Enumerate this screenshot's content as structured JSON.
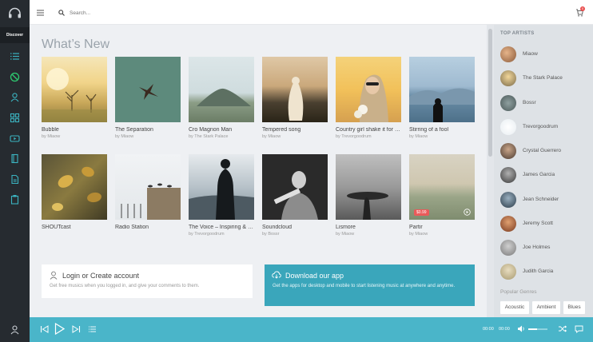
{
  "sidebar": {
    "discover_label": "Discover"
  },
  "search": {
    "placeholder": "Search..."
  },
  "main": {
    "title": "What’s New",
    "cards": [
      {
        "title": "Bubble",
        "artist": "by Miaow"
      },
      {
        "title": "The Separation",
        "artist": "by Miaow"
      },
      {
        "title": "Cro Magnon Man",
        "artist": "by The Stark Palace"
      },
      {
        "title": "Tempered song",
        "artist": "by Miaow"
      },
      {
        "title": "Country girl shake it for me",
        "artist": "by Trevorgoodrum"
      },
      {
        "title": "Stirring of a fool",
        "artist": "by Miaow"
      },
      {
        "title": "SHOUTcast",
        "artist": ""
      },
      {
        "title": "Radio Station",
        "artist": ""
      },
      {
        "title": "The Voice – Inspiring & Emotional",
        "artist": "by Trevorgoodrum"
      },
      {
        "title": "Soundcloud",
        "artist": "by Bossr"
      },
      {
        "title": "Lismore",
        "artist": "by Miaow"
      },
      {
        "title": "Partir",
        "artist": "by Miaow",
        "price": "$0.99"
      }
    ],
    "login": {
      "title": "Login or Create account",
      "text": "Get free musics when you logged in, and give your comments to them."
    },
    "download": {
      "title": "Download our app",
      "text": "Get the apps for desktop and mobile to start listening music at anywhere and anytime."
    }
  },
  "right": {
    "heading": "TOP ARTISTS",
    "artists": [
      "Miaow",
      "The Stark Palace",
      "Bossr",
      "Trevorgoodrum",
      "Crystal Guerrero",
      "James Garcia",
      "Jean Schneider",
      "Jeremy Scott",
      "Joe Holmes",
      "Judith Garcia"
    ],
    "genres_heading": "Popular Genres",
    "genres": [
      "Acoustic",
      "Ambient",
      "Blues"
    ]
  },
  "player": {
    "time_current": "00:00",
    "time_total": "00:00"
  },
  "cart": {
    "count": "0"
  }
}
